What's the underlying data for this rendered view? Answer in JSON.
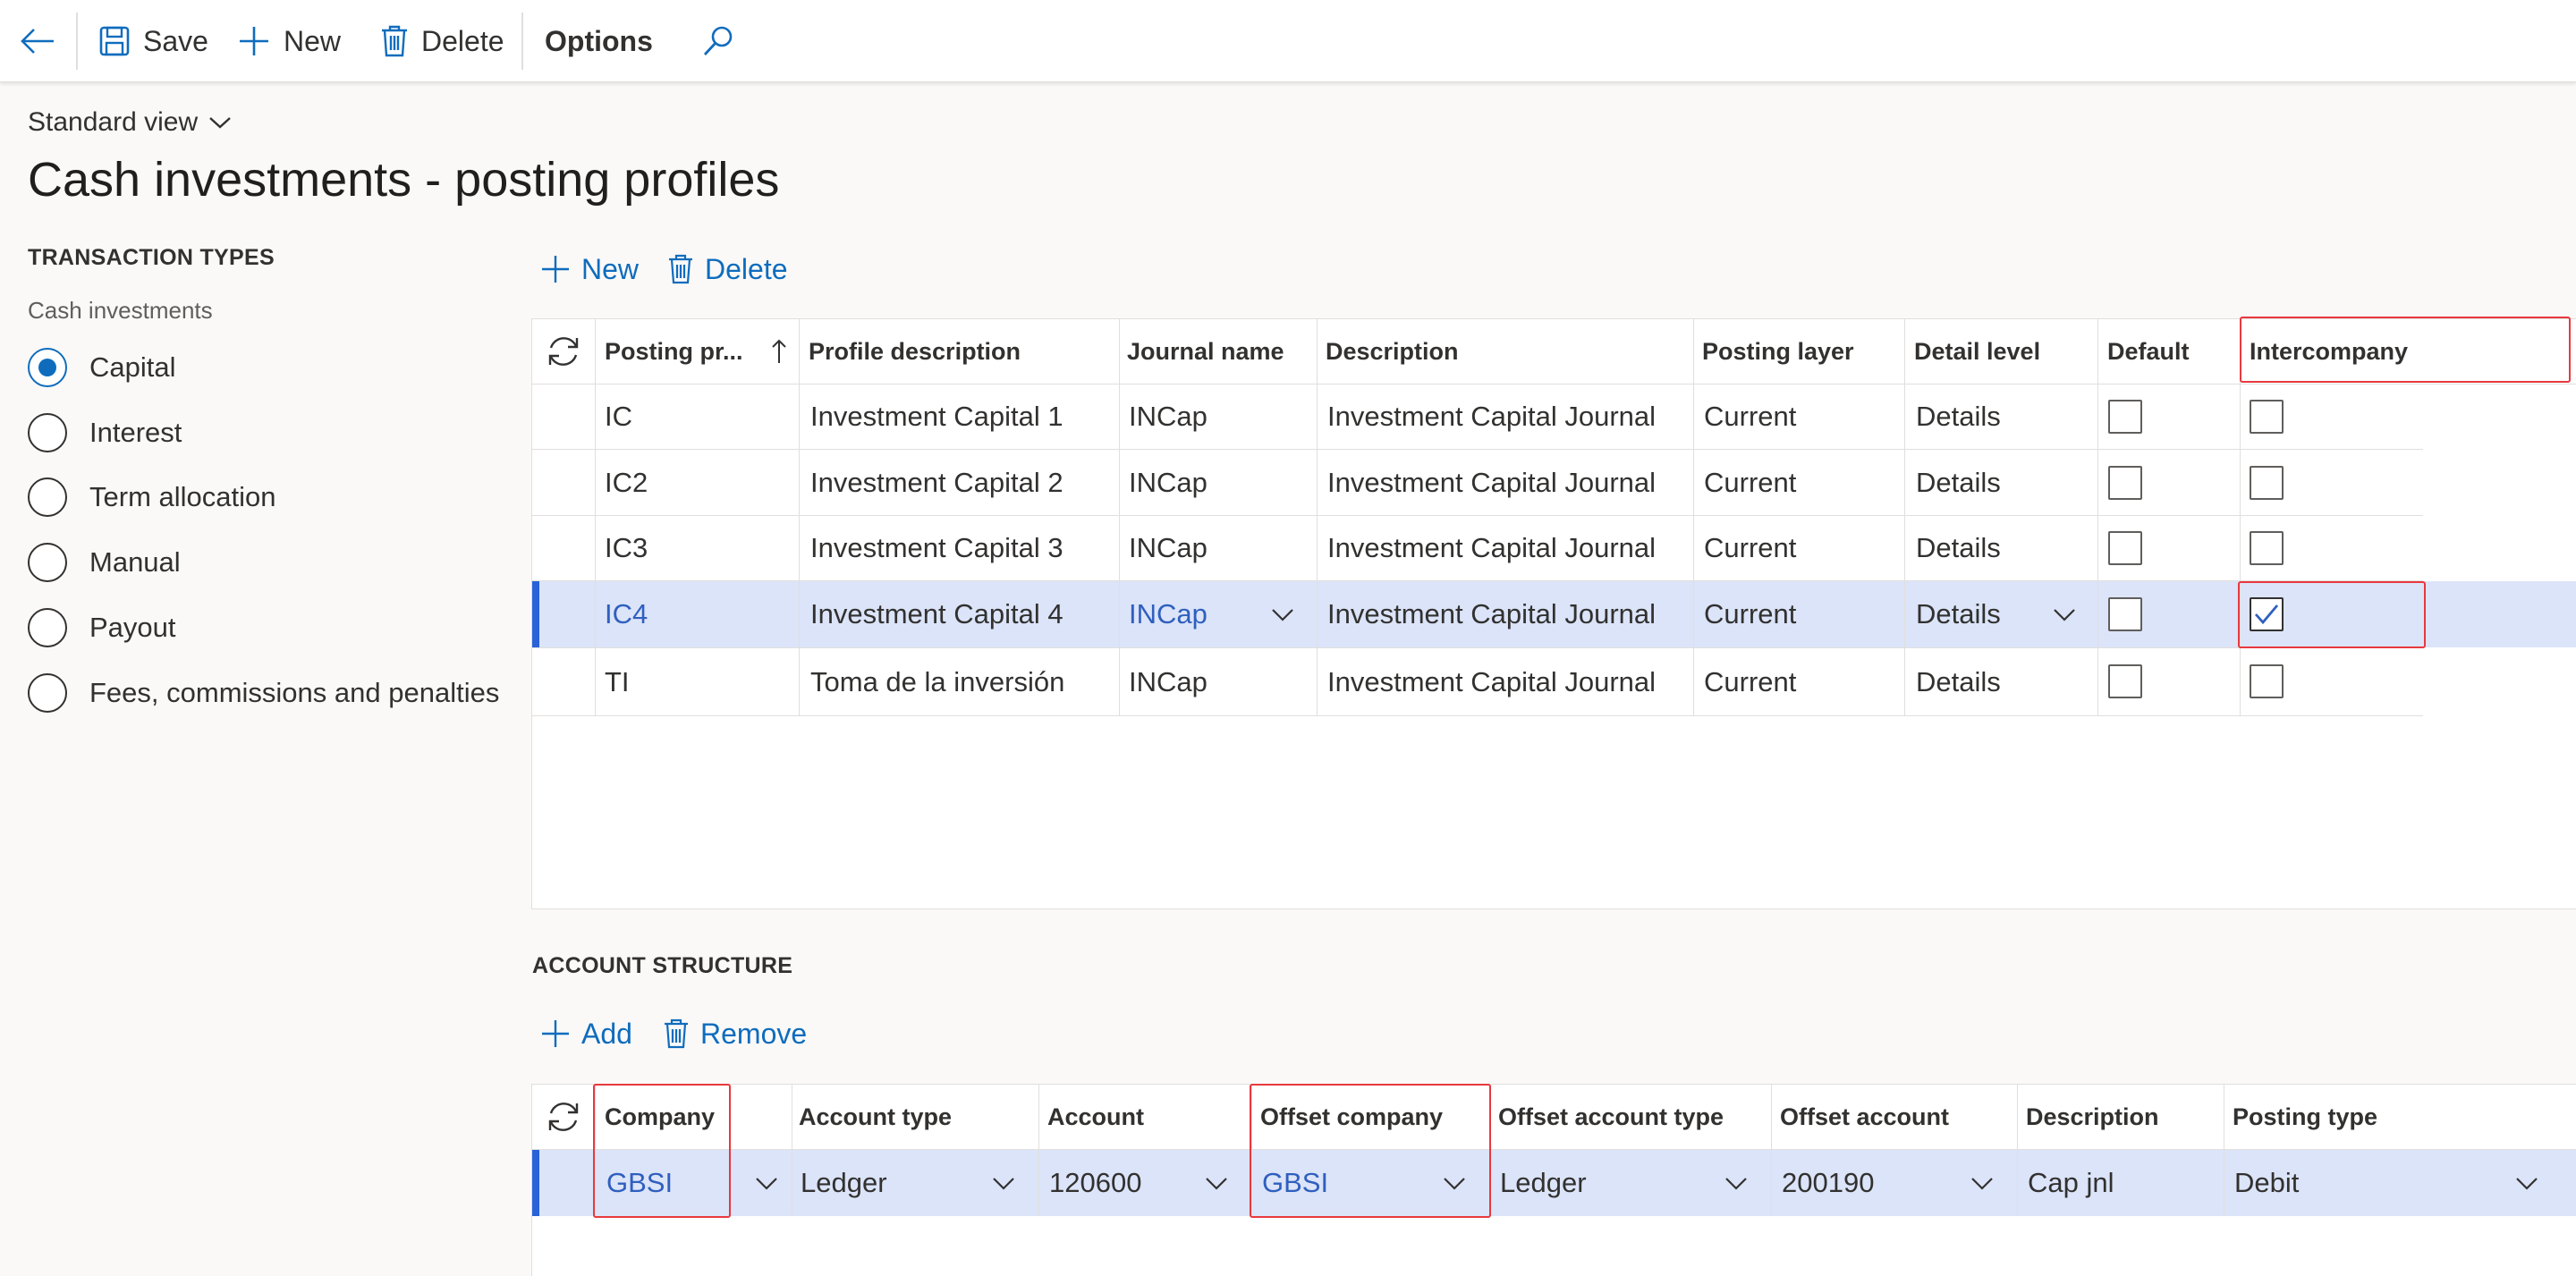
{
  "toolbar": {
    "back_icon": "arrow-left-icon",
    "save_label": "Save",
    "new_label": "New",
    "delete_label": "Delete",
    "options_label": "Options",
    "search_icon": "search-icon"
  },
  "view": {
    "name": "Standard view"
  },
  "page": {
    "title": "Cash investments - posting profiles"
  },
  "transaction_types": {
    "title": "TRANSACTION TYPES",
    "group_label": "Cash investments",
    "options": [
      "Capital",
      "Interest",
      "Term allocation",
      "Manual",
      "Payout",
      "Fees, commissions and penalties"
    ],
    "selected": "Capital"
  },
  "profiles": {
    "new_label": "New",
    "delete_label": "Delete",
    "columns": [
      "Posting pr...",
      "Profile description",
      "Journal name",
      "Description",
      "Posting layer",
      "Detail level",
      "Default",
      "Intercompany"
    ],
    "rows": [
      {
        "posting_profile": "IC",
        "profile_description": "Investment Capital 1",
        "journal_name": "INCap",
        "description": "Investment Capital Journal",
        "posting_layer": "Current",
        "detail_level": "Details",
        "default": false,
        "intercompany": false
      },
      {
        "posting_profile": "IC2",
        "profile_description": "Investment Capital 2",
        "journal_name": "INCap",
        "description": "Investment Capital Journal",
        "posting_layer": "Current",
        "detail_level": "Details",
        "default": false,
        "intercompany": false
      },
      {
        "posting_profile": "IC3",
        "profile_description": "Investment Capital 3",
        "journal_name": "INCap",
        "description": "Investment Capital Journal",
        "posting_layer": "Current",
        "detail_level": "Details",
        "default": false,
        "intercompany": false
      },
      {
        "posting_profile": "IC4",
        "profile_description": "Investment Capital 4",
        "journal_name": "INCap",
        "description": "Investment Capital Journal",
        "posting_layer": "Current",
        "detail_level": "Details",
        "default": false,
        "intercompany": true
      },
      {
        "posting_profile": "TI",
        "profile_description": "Toma de la inversión",
        "journal_name": "INCap",
        "description": "Investment Capital Journal",
        "posting_layer": "Current",
        "detail_level": "Details",
        "default": false,
        "intercompany": false
      }
    ],
    "selected_row": "IC4",
    "highlight_color": "#e8393e",
    "selection_color": "#dbe4f8"
  },
  "account_structure": {
    "title": "ACCOUNT STRUCTURE",
    "add_label": "Add",
    "remove_label": "Remove",
    "columns": [
      "Company",
      "Account type",
      "Account",
      "Offset company",
      "Offset account type",
      "Offset account",
      "Description",
      "Posting type"
    ],
    "row": {
      "company": "GBSI",
      "account_type": "Ledger",
      "account": "120600",
      "offset_company": "GBSI",
      "offset_account_type": "Ledger",
      "offset_account": "200190",
      "description": "Cap jnl",
      "posting_type": "Debit"
    }
  }
}
